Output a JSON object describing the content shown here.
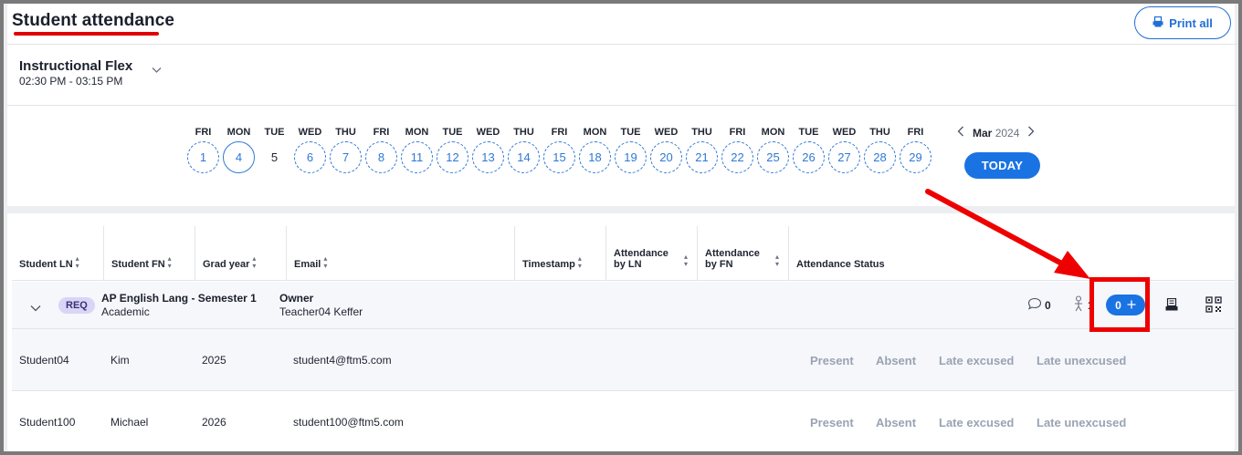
{
  "header": {
    "title": "Student attendance",
    "print_all_label": "Print all"
  },
  "session": {
    "name": "Instructional Flex",
    "time": "02:30 PM - 03:15 PM"
  },
  "calendar": {
    "days": [
      {
        "dow": "FRI",
        "date": "1"
      },
      {
        "dow": "MON",
        "date": "4",
        "today": true
      },
      {
        "dow": "TUE",
        "date": "5",
        "plain": true
      },
      {
        "dow": "WED",
        "date": "6"
      },
      {
        "dow": "THU",
        "date": "7"
      },
      {
        "dow": "FRI",
        "date": "8"
      },
      {
        "dow": "MON",
        "date": "11"
      },
      {
        "dow": "TUE",
        "date": "12"
      },
      {
        "dow": "WED",
        "date": "13"
      },
      {
        "dow": "THU",
        "date": "14"
      },
      {
        "dow": "FRI",
        "date": "15"
      },
      {
        "dow": "MON",
        "date": "18"
      },
      {
        "dow": "TUE",
        "date": "19"
      },
      {
        "dow": "WED",
        "date": "20"
      },
      {
        "dow": "THU",
        "date": "21"
      },
      {
        "dow": "FRI",
        "date": "22"
      },
      {
        "dow": "MON",
        "date": "25"
      },
      {
        "dow": "TUE",
        "date": "26"
      },
      {
        "dow": "WED",
        "date": "27"
      },
      {
        "dow": "THU",
        "date": "28"
      },
      {
        "dow": "FRI",
        "date": "29"
      }
    ],
    "month": "Mar",
    "year": "2024",
    "today_label": "TODAY"
  },
  "table": {
    "columns": {
      "student_ln": "Student LN",
      "student_fn": "Student FN",
      "grad_year": "Grad year",
      "email": "Email",
      "timestamp": "Timestamp",
      "att_ln_1": "Attendance",
      "att_ln_2": "by LN",
      "att_fn_1": "Attendance",
      "att_fn_2": "by FN",
      "status": "Attendance Status"
    },
    "group": {
      "badge": "REQ",
      "course": "AP English Lang - Semester 1",
      "course_type": "Academic",
      "owner_label": "Owner",
      "owner_name": "Teacher04 Keffer",
      "comment_count": "0",
      "person_count": "1",
      "pill_count": "0"
    },
    "rows": [
      {
        "ln": "Student04",
        "fn": "Kim",
        "grad": "2025",
        "email": "student4@ftm5.com",
        "statuses": [
          "Present",
          "Absent",
          "Late excused",
          "Late unexcused"
        ]
      },
      {
        "ln": "Student100",
        "fn": "Michael",
        "grad": "2026",
        "email": "student100@ftm5.com",
        "statuses": [
          "Present",
          "Absent",
          "Late excused",
          "Late unexcused"
        ]
      }
    ]
  },
  "colors": {
    "accent": "#1a73e3",
    "annotation": "#ee0000",
    "req_badge": "#d8d5f7",
    "status_text": "#9aa3b2"
  },
  "icons": [
    "printer-icon",
    "chevron-down-icon",
    "chevron-left-icon",
    "chevron-right-icon",
    "sort-icon",
    "comment-icon",
    "person-icon",
    "plus-icon",
    "qr-code-icon"
  ]
}
